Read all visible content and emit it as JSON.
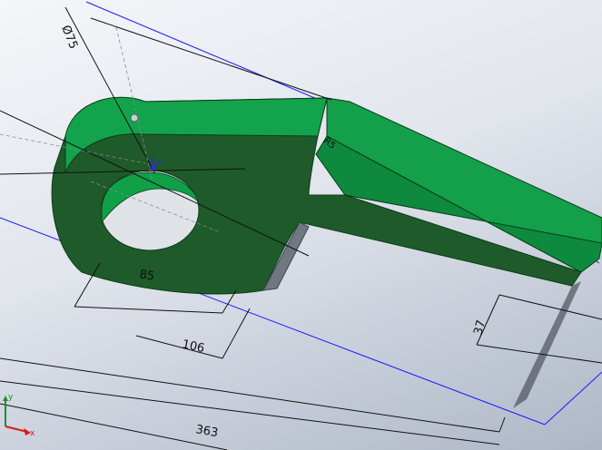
{
  "viewport": {
    "background_top": "#f4f6f9",
    "background_bottom": "#aeb7c7"
  },
  "part": {
    "face_color": "#1f5a2a",
    "side_color": "#0d8a3e",
    "top_color": "#14a04a",
    "hole_color": "#0fa048"
  },
  "dimensions": {
    "diameter": "Ø75",
    "width_inner": "85",
    "width_outer": "106",
    "thickness": "37",
    "overall_length": "363",
    "radius_small": "R5"
  },
  "sketch_lines": {
    "dimension_color": "#111111",
    "projection_color": "#1a1aff",
    "construction_color": "#8a8a8a"
  },
  "triad": {
    "x_label": "x",
    "y_label": "y",
    "x_color": "#d81b1b",
    "y_color": "#1f8f2f"
  },
  "origin": {
    "color": "#2b2bd6"
  }
}
